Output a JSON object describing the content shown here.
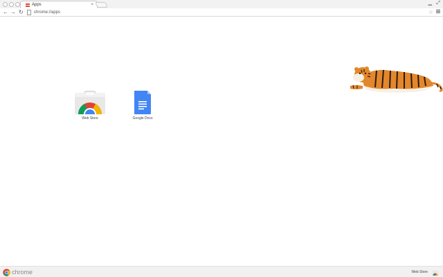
{
  "tabstrip": {
    "tab_title": "Apps",
    "tab_close": "×",
    "minimize_glyph": "▁",
    "expand_glyph": "⤢"
  },
  "toolbar": {
    "back_glyph": "←",
    "forward_glyph": "→",
    "reload_glyph": "↻",
    "url": "chrome://apps",
    "star_glyph": "☆"
  },
  "apps": [
    {
      "label": "Web Store",
      "icon": "chrome-web-store-icon"
    },
    {
      "label": "Google Docs",
      "icon": "google-docs-icon"
    }
  ],
  "bottom_bar": {
    "wordmark": "chrome",
    "store_link": "Web Store"
  },
  "colors": {
    "chrome_red": "#db4437",
    "chrome_green": "#0f9d58",
    "chrome_yellow": "#f4b400",
    "chrome_blue": "#4285f4",
    "docs_blue": "#4285f4"
  }
}
